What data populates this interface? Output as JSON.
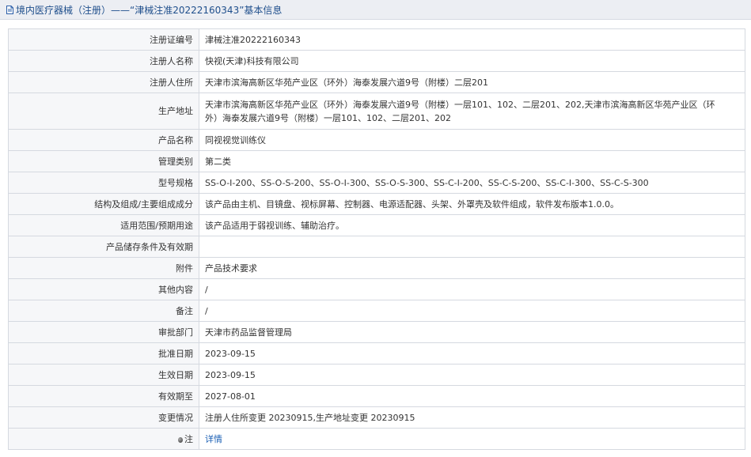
{
  "header": {
    "title": "境内医疗器械（注册）——“津械注准20222160343”基本信息"
  },
  "rows": [
    {
      "label": "注册证编号",
      "value": "津械注准20222160343"
    },
    {
      "label": "注册人名称",
      "value": "快视(天津)科技有限公司"
    },
    {
      "label": "注册人住所",
      "value": "天津市滨海高新区华苑产业区（环外）海泰发展六道9号（附楼）二层201"
    },
    {
      "label": "生产地址",
      "value_line1": "天津市滨海高新区华苑产业区（环外）海泰发展六道9号（附楼）一层101、102、二层201、202,天津市滨海高新区华苑产业区（环",
      "value_line2": "外）海泰发展六道9号（附楼）一层101、102、二层201、202"
    },
    {
      "label": "产品名称",
      "value": "同视视觉训练仪"
    },
    {
      "label": "管理类别",
      "value": "第二类"
    },
    {
      "label": "型号规格",
      "value": "SS-O-I-200、SS-O-S-200、SS-O-I-300、SS-O-S-300、SS-C-I-200、SS-C-S-200、SS-C-I-300、SS-C-S-300"
    },
    {
      "label": "结构及组成/主要组成成分",
      "value": "该产品由主机、目镜盘、视标屏幕、控制器、电源适配器、头架、外罩壳及软件组成，软件发布版本1.0.0。"
    },
    {
      "label": "适用范围/预期用途",
      "value": "该产品适用于弱视训练、辅助治疗。"
    },
    {
      "label": "产品储存条件及有效期",
      "value": ""
    },
    {
      "label": "附件",
      "value": "产品技术要求"
    },
    {
      "label": "其他内容",
      "value": "/"
    },
    {
      "label": "备注",
      "value": "/"
    },
    {
      "label": "审批部门",
      "value": "天津市药品监督管理局"
    },
    {
      "label": "批准日期",
      "value": "2023-09-15"
    },
    {
      "label": "生效日期",
      "value": "2023-09-15"
    },
    {
      "label": "有效期至",
      "value": "2027-08-01"
    },
    {
      "label": "变更情况",
      "value": "注册人住所变更 20230915,生产地址变更 20230915"
    },
    {
      "label": "注",
      "value": "详情"
    }
  ]
}
